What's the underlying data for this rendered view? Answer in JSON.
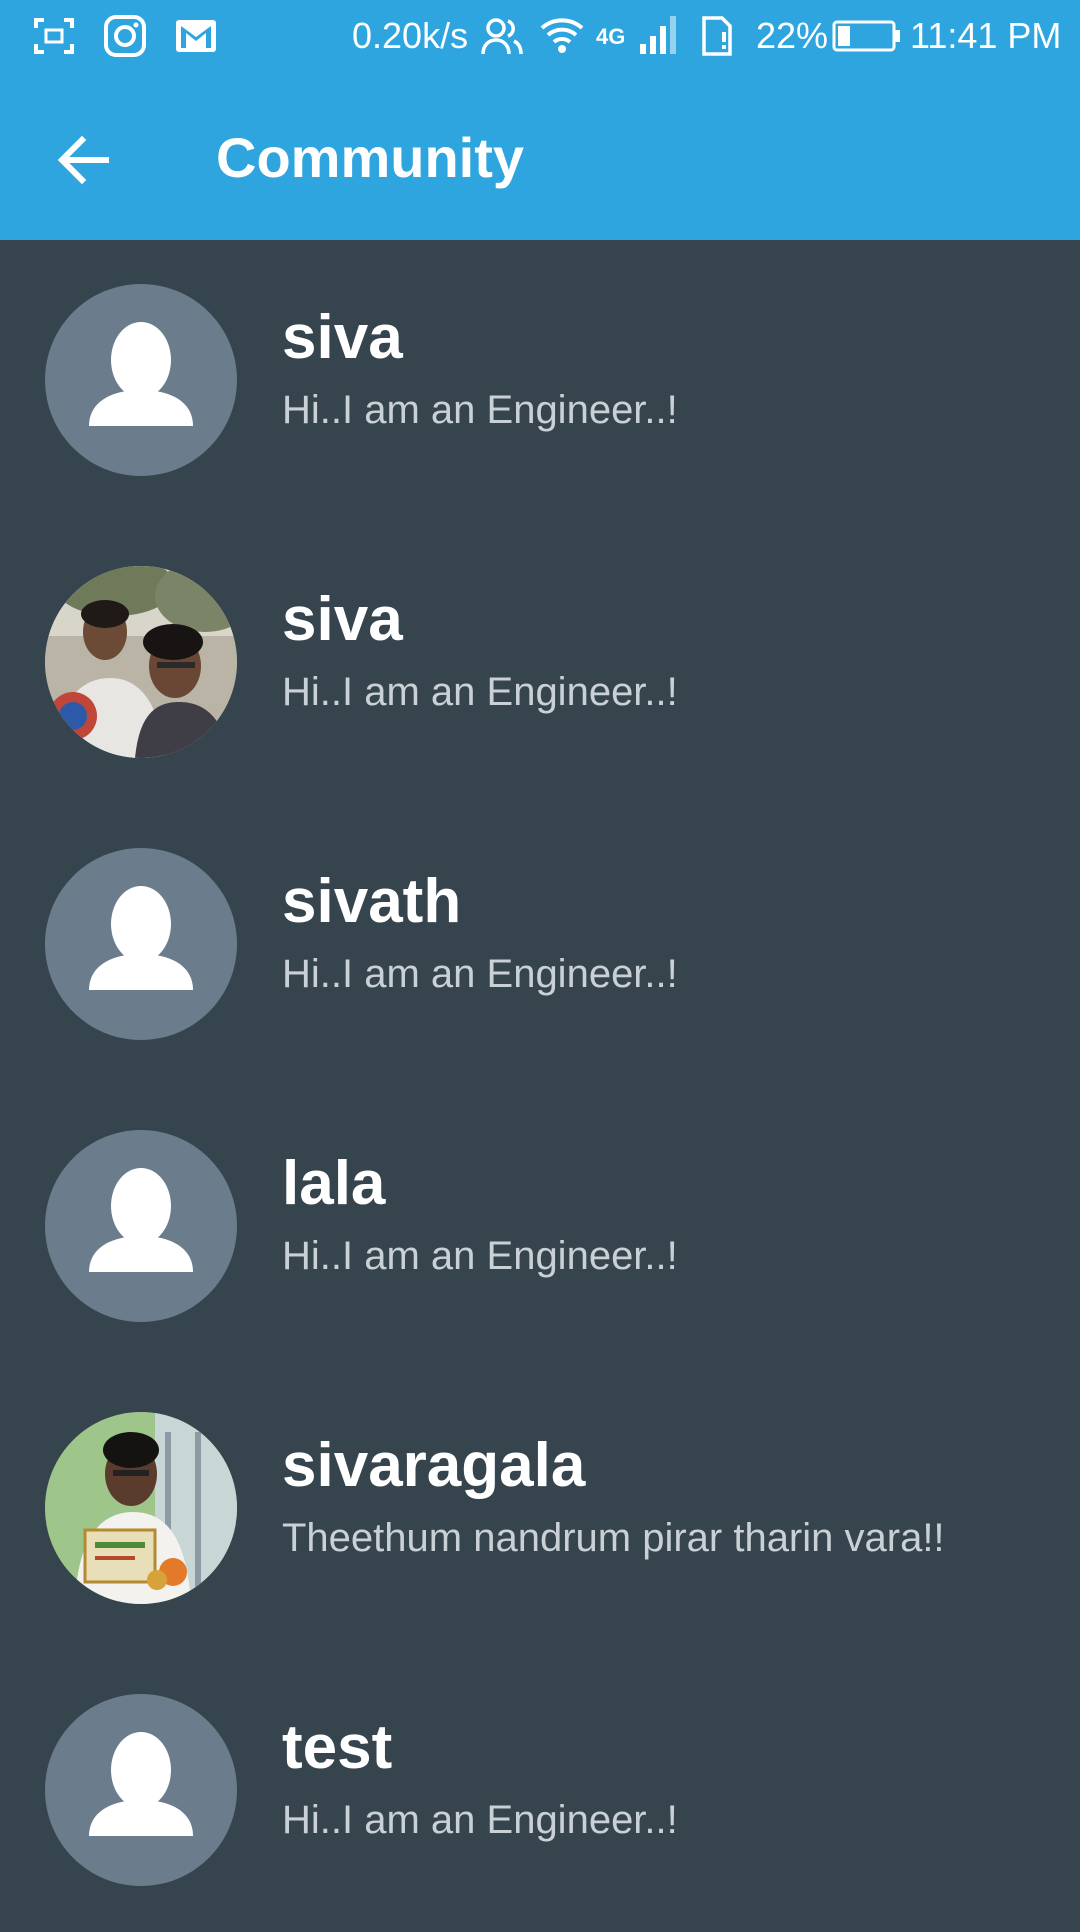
{
  "status_bar": {
    "net_speed": "0.20k/s",
    "network_type": "4G",
    "battery_percent": "22%",
    "battery_level": 0.22,
    "time": "11:41 PM",
    "icons": [
      "screenshot-icon",
      "instagram-icon",
      "gmail-icon",
      "contacts-icon",
      "wifi-icon",
      "signal-icon",
      "sim-icon",
      "battery-icon"
    ]
  },
  "app_bar": {
    "title": "Community",
    "back_icon": "arrow-left-icon"
  },
  "colors": {
    "primary": "#2fa5e0",
    "background": "#35444d",
    "avatar_placeholder": "#6b7d8d"
  },
  "users": [
    {
      "name": "siva",
      "status": "Hi..I am an Engineer..!",
      "avatar": "placeholder-person-icon"
    },
    {
      "name": "siva",
      "status": "Hi..I am an Engineer..!",
      "avatar": "photo"
    },
    {
      "name": "sivath",
      "status": "Hi..I am an Engineer..!",
      "avatar": "placeholder-person-icon"
    },
    {
      "name": "lala",
      "status": "Hi..I am an Engineer..!",
      "avatar": "placeholder-person-icon"
    },
    {
      "name": "sivaragala",
      "status": "Theethum nandrum pirar tharin vara!!",
      "avatar": "photo"
    },
    {
      "name": "test",
      "status": "Hi..I am an Engineer..!",
      "avatar": "placeholder-person-icon"
    }
  ]
}
